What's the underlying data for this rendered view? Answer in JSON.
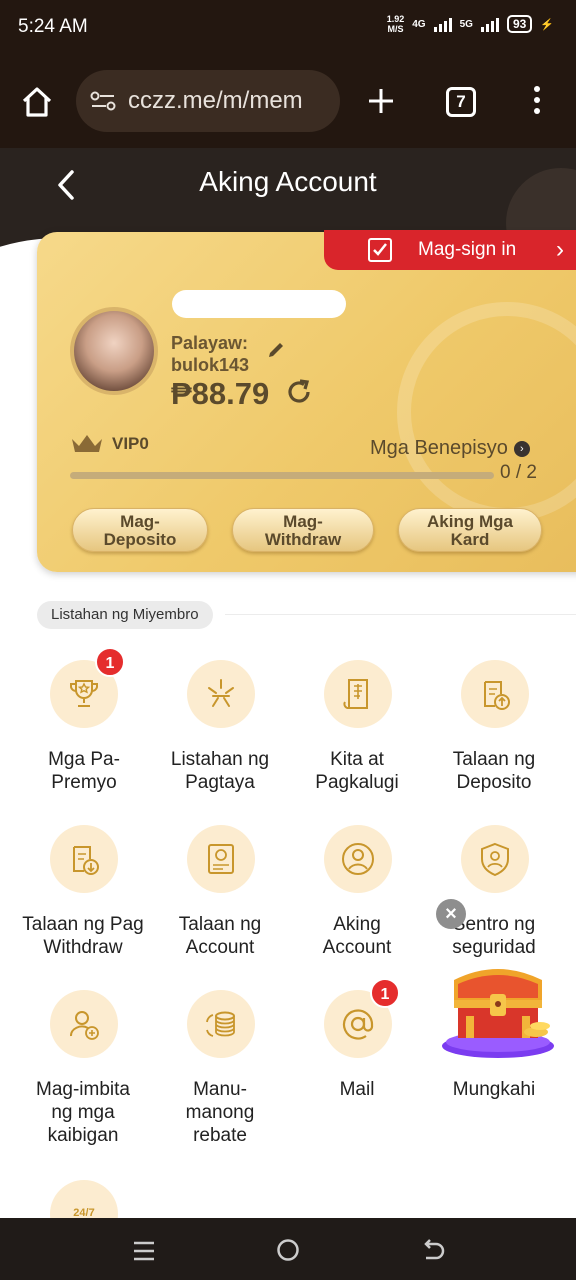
{
  "status": {
    "time": "5:24 AM",
    "speed_value": "1.92",
    "speed_unit": "M/S",
    "net1": "4G",
    "net2": "5G",
    "battery": "93"
  },
  "browser": {
    "url": "cczz.me/m/mem",
    "tab_count": "7"
  },
  "header": {
    "title": "Aking Account"
  },
  "card": {
    "signin_label": "Mag-sign in",
    "nickname_label": "Palayaw:",
    "nickname": "bulok143",
    "balance": "₱88.79",
    "vip_label": "VIP0",
    "benefits_label": "Mga Benepisyo",
    "progress_text": "0 / 2",
    "progress_value": 0,
    "deposit_label": "Mag-\nDeposito",
    "withdraw_label": "Mag-\nWithdraw",
    "cards_label": "Aking Mga\nKard"
  },
  "section": {
    "title": "Listahan ng Miyembro"
  },
  "menu": [
    {
      "label": "Mga Pa-\nPremyo",
      "icon": "trophy-icon",
      "badge": "1"
    },
    {
      "label": "Listahan ng\nPagtaya",
      "icon": "sparkle-icon"
    },
    {
      "label": "Kita at\nPagkalugi",
      "icon": "receipt-icon"
    },
    {
      "label": "Talaan ng\nDeposito",
      "icon": "clipboard-up-icon"
    },
    {
      "label": "Talaan ng Pag\nWithdraw",
      "icon": "clipboard-down-icon"
    },
    {
      "label": "Talaan ng\nAccount",
      "icon": "ledger-icon"
    },
    {
      "label": "Aking\nAccount",
      "icon": "user-icon"
    },
    {
      "label": "Sentro ng\nseguridad",
      "icon": "shield-user-icon"
    },
    {
      "label": "Mag-imbita\nng mga\nkaibigan",
      "icon": "add-user-icon"
    },
    {
      "label": "Manu-\nmanong\nrebate",
      "icon": "coins-icon"
    },
    {
      "label": "Mail",
      "icon": "at-icon",
      "badge": "1"
    },
    {
      "label": "Mungkahi",
      "icon": "chest-icon"
    }
  ],
  "support_icon_text": "24/7",
  "colors": {
    "gold": "#efc96a",
    "dark": "#231710",
    "red": "#d9252b",
    "badge": "#e52d2d"
  }
}
